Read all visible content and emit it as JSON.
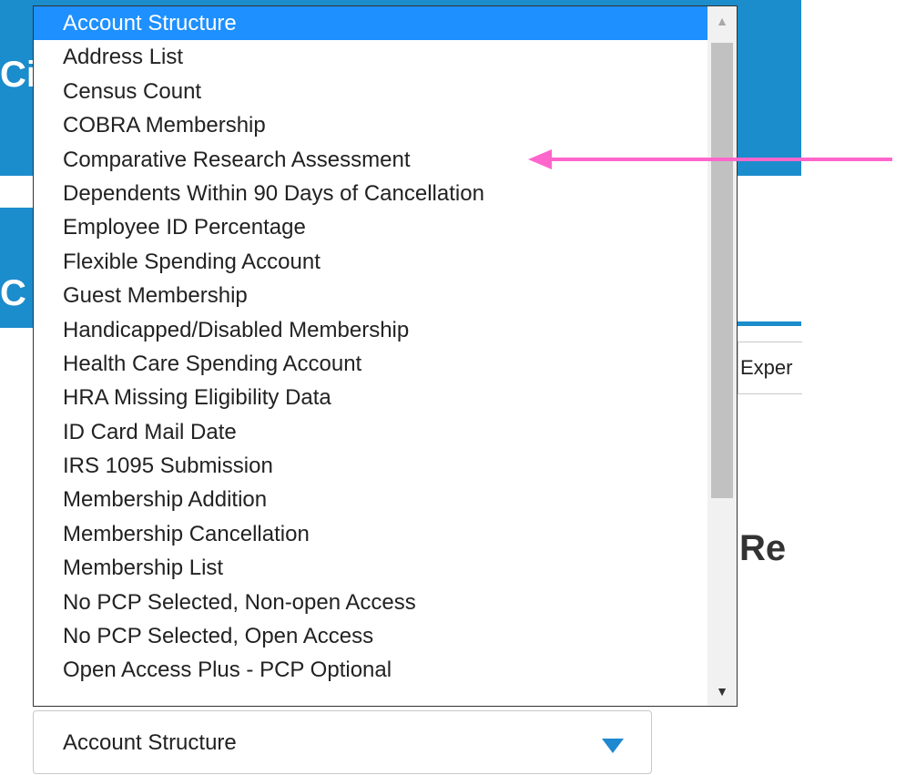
{
  "background": {
    "fragment_ci": "Ci",
    "fragment_c": "C",
    "fragment_exper": "Exper",
    "fragment_re": "Re",
    "accent_color": "#1b8ccc"
  },
  "dropdown": {
    "selected_index": 0,
    "items": [
      "Account Structure",
      "Address List",
      "Census Count",
      "COBRA Membership",
      "Comparative Research Assessment",
      "Dependents Within 90 Days of Cancellation",
      "Employee ID Percentage",
      "Flexible Spending Account",
      "Guest Membership",
      "Handicapped/Disabled Membership",
      "Health Care Spending Account",
      "HRA Missing Eligibility Data",
      "ID Card Mail Date",
      "IRS 1095 Submission",
      "Membership Addition",
      "Membership Cancellation",
      "Membership List",
      "No PCP Selected, Non-open Access",
      "No PCP Selected, Open Access",
      "Open Access Plus - PCP Optional"
    ],
    "highlight_color": "#1e90ff",
    "scroll_up_icon": "▲",
    "scroll_down_icon": "▼"
  },
  "select": {
    "value": "Account Structure",
    "caret_icon": "chevron-down-icon"
  },
  "annotation": {
    "arrow_color": "#ff66cc",
    "points_to": "Comparative Research Assessment"
  }
}
